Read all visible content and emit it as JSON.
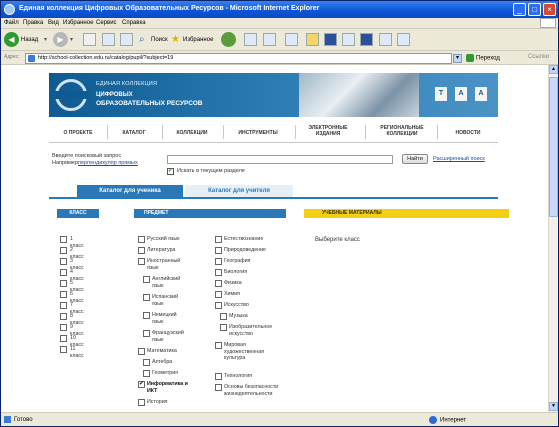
{
  "window": {
    "title": "Единая коллекция Цифровых Образовательных Ресурсов - Microsoft Internet Explorer",
    "controls": [
      "_",
      "□",
      "×"
    ]
  },
  "menubar": [
    "Файл",
    "Правка",
    "Вид",
    "Избранное",
    "Сервис",
    "Справка"
  ],
  "toolbar": {
    "back": "Назад",
    "search": "Поиск",
    "favorites": "Избранное"
  },
  "addressbar": {
    "label": "Адрес:",
    "url": "http://school-collection.edu.ru/catalog/pupil/?subject=19",
    "go": "Переход",
    "links": "Ссылки"
  },
  "site": {
    "line1": "ЕДИНАЯ КОЛЛЕКЦИЯ",
    "line2": "ЦИФРОВЫХ",
    "line3": "ОБРАЗОВАТЕЛЬНЫХ РЕСУРСОВ"
  },
  "nav": [
    "О ПРОЕКТЕ",
    "КАТАЛОГ",
    "КОЛЛЕКЦИИ",
    "ИНСТРУМЕНТЫ",
    "ЭЛЕКТРОННЫЕ ИЗДАНИЯ",
    "РЕГИОНАЛЬНЫЕ КОЛЛЕКЦИИ",
    "НОВОСТИ"
  ],
  "search": {
    "label": "Введите поисковый запрос",
    "example_label": "Например:",
    "example_link": "перпендикуляр прямых",
    "checkbox_label": "Искать в текущем разделе",
    "checkbox_checked": true,
    "find_button": "Найти",
    "advanced_link": "Расширенный поиск"
  },
  "tabs": {
    "student": "Каталог для ученика",
    "teacher": "Каталог для учителя"
  },
  "columns": {
    "class": "КЛАСС",
    "subject": "ПРЕДМЕТ",
    "materials": "УЧЕБНЫЕ МАТЕРИАЛЫ"
  },
  "classes": [
    "1 класс",
    "2 класс",
    "3 класс",
    "4 класс",
    "5 класс",
    "6 класс",
    "7 класс",
    "8 класс",
    "9 класс",
    "10 класс",
    "11 класс"
  ],
  "subjects_col1": [
    {
      "label": "Русский язык",
      "checked": false
    },
    {
      "label": "Литература",
      "checked": false
    },
    {
      "label": "Иностранный язык",
      "checked": false
    },
    {
      "label": "Английский язык",
      "checked": false
    },
    {
      "label": "Испанский язык",
      "checked": false
    },
    {
      "label": "Немецкий язык",
      "checked": false
    },
    {
      "label": "Французский язык",
      "checked": false
    },
    {
      "label": "Математика",
      "checked": false
    },
    {
      "label": "Алгебра",
      "checked": false
    },
    {
      "label": "Геометрия",
      "checked": false
    },
    {
      "label": "Информатика и ИКТ",
      "checked": true
    },
    {
      "label": "История",
      "checked": false
    }
  ],
  "subjects_col2": [
    {
      "label": "Естествознание",
      "checked": false
    },
    {
      "label": "Природоведение",
      "checked": false
    },
    {
      "label": "География",
      "checked": false
    },
    {
      "label": "Биология",
      "checked": false
    },
    {
      "label": "Физика",
      "checked": false
    },
    {
      "label": "Химия",
      "checked": false
    },
    {
      "label": "Искусство",
      "checked": false
    },
    {
      "label": "Музыка",
      "checked": false
    },
    {
      "label": "Изобразительное искусство",
      "checked": false
    },
    {
      "label": "Мировая художественная культура",
      "checked": false
    },
    {
      "label": "Технология",
      "checked": false
    },
    {
      "label": "Основы безопасности жизнедеятельности",
      "checked": false
    }
  ],
  "materials": {
    "prompt": "Выберите класс"
  },
  "status": {
    "left": "Готово",
    "zone": "Интернет"
  }
}
